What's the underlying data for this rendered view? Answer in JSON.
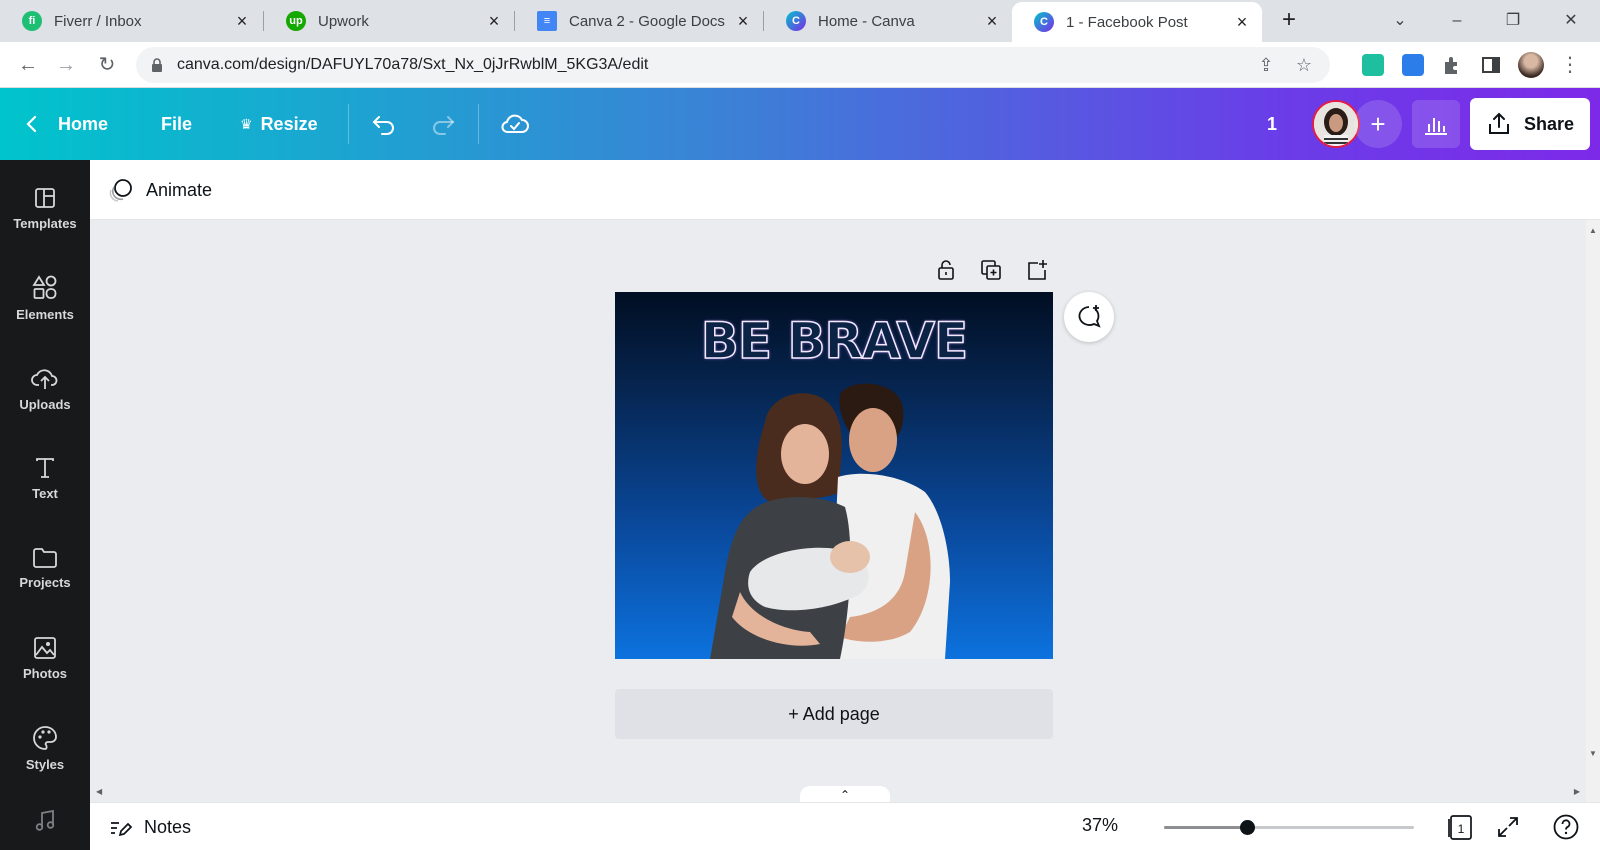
{
  "browser": {
    "tabs": [
      {
        "title": "Fiverr / Inbox",
        "favicon": "fiverr-logo",
        "color": "#1dbf73",
        "glyph": "fi"
      },
      {
        "title": "Upwork",
        "favicon": "upwork-logo",
        "color": "#14a800",
        "glyph": "up"
      },
      {
        "title": "Canva 2 - Google Docs",
        "favicon": "google-docs-logo",
        "color": "#4285f4",
        "glyph": "≡"
      },
      {
        "title": "Home - Canva",
        "favicon": "canva-logo",
        "color": "#7d2ae8",
        "glyph": "C"
      },
      {
        "title": "1 - Facebook Post",
        "favicon": "canva-logo",
        "color": "#00c4cc",
        "glyph": "C"
      }
    ],
    "url": "canva.com/design/DAFUYL70a78/Sxt_Nx_0jJrRwblM_5KG3A/edit"
  },
  "header": {
    "home_label": "Home",
    "file_label": "File",
    "resize_label": "Resize",
    "page_count": "1",
    "share_label": "Share"
  },
  "sidebar": {
    "items": [
      {
        "label": "Templates",
        "icon": "templates-icon"
      },
      {
        "label": "Elements",
        "icon": "elements-icon"
      },
      {
        "label": "Uploads",
        "icon": "uploads-icon"
      },
      {
        "label": "Text",
        "icon": "text-icon"
      },
      {
        "label": "Projects",
        "icon": "projects-icon"
      },
      {
        "label": "Photos",
        "icon": "photos-icon"
      },
      {
        "label": "Styles",
        "icon": "styles-icon"
      }
    ]
  },
  "context": {
    "animate_label": "Animate"
  },
  "design": {
    "title_text": "BE BRAVE",
    "add_page_label": "+ Add page"
  },
  "footer": {
    "notes_label": "Notes",
    "zoom": "37%",
    "zoom_fraction": 0.33,
    "page_indicator": "1"
  },
  "colors": {
    "accent_teal": "#00c4cc",
    "accent_purple": "#7d2ae8",
    "sidebar_bg": "#18191b"
  }
}
